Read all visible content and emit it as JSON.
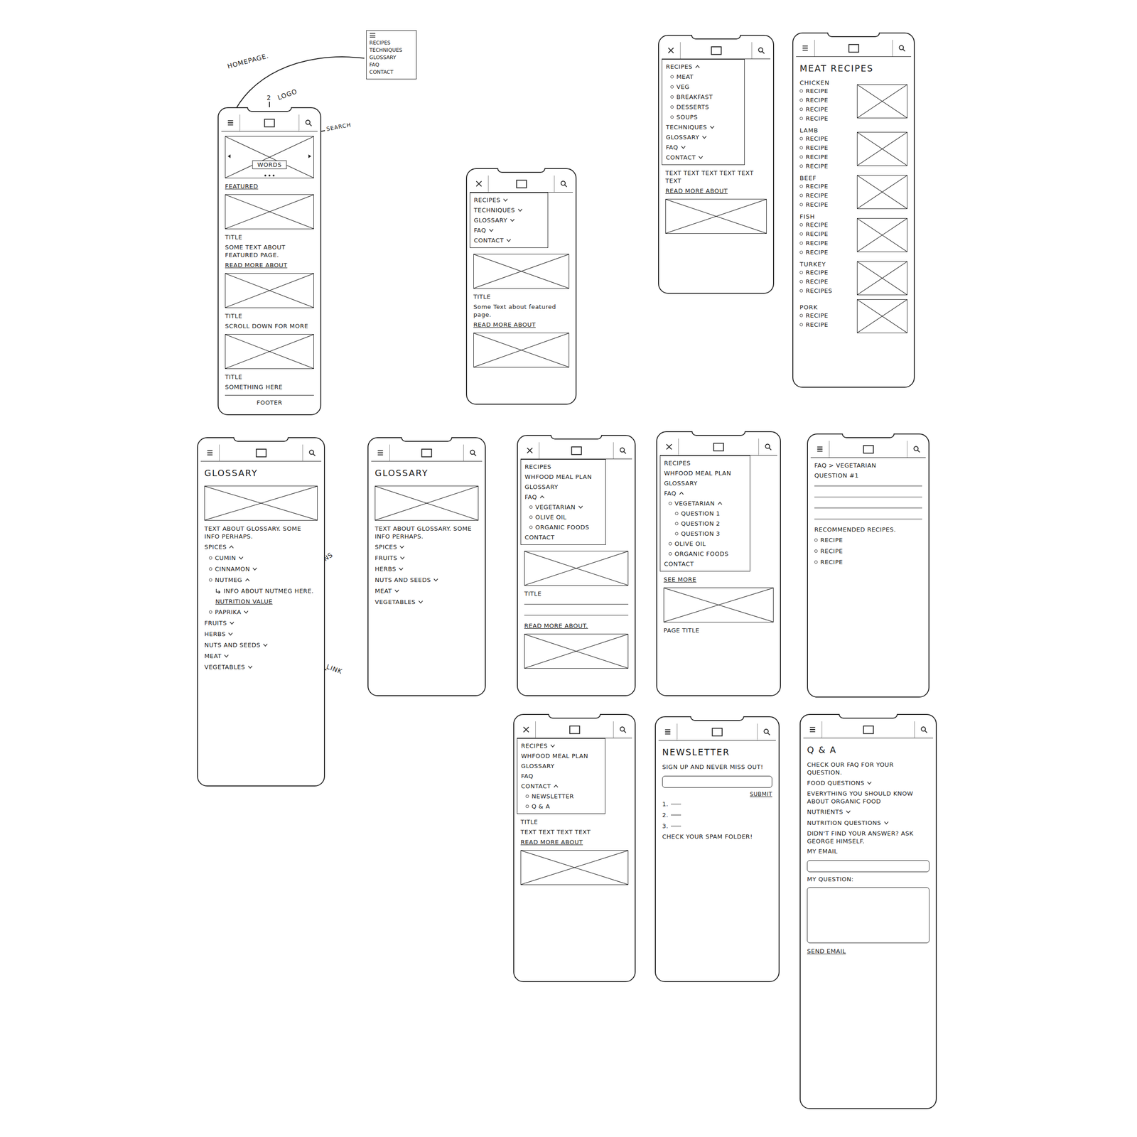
{
  "annotations": [
    {
      "text": "HOMEPAGE."
    },
    {
      "text": "2"
    },
    {
      "text": "LOGO"
    },
    {
      "text": "SEARCH"
    },
    {
      "text": "DROP DOWNS"
    },
    {
      "text": "LINK"
    }
  ],
  "menu_note": {
    "items": [
      "RECIPES",
      "TECHNIQUES",
      "GLOSSARY",
      "FAQ",
      "CONTACT"
    ]
  },
  "screens": [
    {
      "menu_open": false,
      "blocks": [
        {
          "kind": "carousel",
          "text": "WORDS"
        },
        {
          "kind": "link",
          "text": "FEATURED"
        },
        {
          "kind": "image"
        },
        {
          "kind": "text",
          "text": "TITLE"
        },
        {
          "kind": "text",
          "text": "SOME TEXT ABOUT FEATURED PAGE."
        },
        {
          "kind": "link",
          "text": "READ MORE ABOUT"
        },
        {
          "kind": "image"
        },
        {
          "kind": "text",
          "text": "TITLE"
        },
        {
          "kind": "text",
          "text": "SCROLL DOWN FOR MORE"
        },
        {
          "kind": "image"
        },
        {
          "kind": "text",
          "text": "TITLE"
        },
        {
          "kind": "text",
          "text": "SOMETHING HERE"
        },
        {
          "kind": "footer",
          "text": "FOOTER"
        }
      ]
    },
    {
      "menu_open": true,
      "blocks": [
        {
          "kind": "menu",
          "items": [
            {
              "kind": "toggle",
              "text": "RECIPES",
              "expanded": false,
              "level": 0
            },
            {
              "kind": "toggle",
              "text": "TECHNIQUES",
              "expanded": false,
              "level": 0
            },
            {
              "kind": "toggle",
              "text": "GLOSSARY",
              "expanded": false,
              "level": 0
            },
            {
              "kind": "toggle",
              "text": "FAQ",
              "expanded": false,
              "level": 0
            },
            {
              "kind": "toggle",
              "text": "CONTACT",
              "expanded": false,
              "level": 0
            }
          ]
        },
        {
          "kind": "image"
        },
        {
          "kind": "text",
          "text": "TITLE"
        },
        {
          "kind": "text",
          "text": "Some Text about featured page."
        },
        {
          "kind": "link",
          "text": "READ MORE ABOUT"
        },
        {
          "kind": "image"
        }
      ]
    },
    {
      "menu_open": true,
      "blocks": [
        {
          "kind": "menu",
          "items": [
            {
              "kind": "toggle",
              "text": "RECIPES",
              "expanded": true,
              "level": 0
            },
            {
              "kind": "item",
              "text": "MEAT",
              "level": 1
            },
            {
              "kind": "item",
              "text": "VEG",
              "level": 1
            },
            {
              "kind": "item",
              "text": "BREAKFAST",
              "level": 1
            },
            {
              "kind": "item",
              "text": "DESSERTS",
              "level": 1
            },
            {
              "kind": "item",
              "text": "SOUPS",
              "level": 1
            },
            {
              "kind": "toggle",
              "text": "TECHNIQUES",
              "expanded": false,
              "level": 0
            },
            {
              "kind": "toggle",
              "text": "GLOSSARY",
              "expanded": false,
              "level": 0
            },
            {
              "kind": "toggle",
              "text": "FAQ",
              "expanded": false,
              "level": 0
            },
            {
              "kind": "toggle",
              "text": "CONTACT",
              "expanded": false,
              "level": 0
            }
          ]
        },
        {
          "kind": "text",
          "text": "TEXT TEXT TEXT TEXT TEXT TEXT"
        },
        {
          "kind": "link",
          "text": "READ MORE ABOUT"
        },
        {
          "kind": "image"
        }
      ]
    },
    {
      "menu_open": false,
      "blocks": [
        {
          "kind": "heading",
          "text": "MEAT RECIPES"
        },
        {
          "kind": "group",
          "title": "CHICKEN",
          "items": [
            "RECIPE",
            "RECIPE",
            "RECIPE",
            "RECIPE"
          ]
        },
        {
          "kind": "group",
          "title": "LAMB",
          "items": [
            "RECIPE",
            "RECIPE",
            "RECIPE",
            "RECIPE"
          ]
        },
        {
          "kind": "group",
          "title": "BEEF",
          "items": [
            "RECIPE",
            "RECIPE",
            "RECIPE"
          ]
        },
        {
          "kind": "group",
          "title": "FISH",
          "items": [
            "RECIPE",
            "RECIPE",
            "RECIPE",
            "RECIPE"
          ]
        },
        {
          "kind": "group",
          "title": "TURKEY",
          "items": [
            "RECIPE",
            "RECIPE",
            "RECIPES"
          ]
        },
        {
          "kind": "group",
          "title": "PORK",
          "items": [
            "RECIPE",
            "RECIPE"
          ]
        }
      ]
    },
    {
      "menu_open": false,
      "blocks": [
        {
          "kind": "heading",
          "text": "GLOSSARY"
        },
        {
          "kind": "image"
        },
        {
          "kind": "text",
          "text": "TEXT ABOUT GLOSSARY. SOME INFO PERHAPS."
        },
        {
          "kind": "toggle",
          "text": "SPICES",
          "expanded": true,
          "level": 0
        },
        {
          "kind": "toggle",
          "text": "CUMIN",
          "expanded": false,
          "level": 1
        },
        {
          "kind": "toggle",
          "text": "CINNAMON",
          "expanded": false,
          "level": 1
        },
        {
          "kind": "toggle",
          "text": "NUTMEG",
          "expanded": true,
          "level": 1
        },
        {
          "kind": "note",
          "text": "INFO ABOUT NUTMEG HERE.",
          "level": 2
        },
        {
          "kind": "link",
          "text": "NUTRITION VALUE",
          "level": 2
        },
        {
          "kind": "toggle",
          "text": "PAPRIKA",
          "expanded": false,
          "level": 1
        },
        {
          "kind": "toggle",
          "text": "FRUITS",
          "expanded": false,
          "level": 0
        },
        {
          "kind": "toggle",
          "text": "HERBS",
          "expanded": false,
          "level": 0
        },
        {
          "kind": "toggle",
          "text": "NUTS AND SEEDS",
          "expanded": false,
          "level": 0
        },
        {
          "kind": "toggle",
          "text": "MEAT",
          "expanded": false,
          "level": 0
        },
        {
          "kind": "toggle",
          "text": "VEGETABLES",
          "expanded": false,
          "level": 0
        }
      ]
    },
    {
      "menu_open": false,
      "blocks": [
        {
          "kind": "heading",
          "text": "GLOSSARY"
        },
        {
          "kind": "image"
        },
        {
          "kind": "text",
          "text": "TEXT ABOUT GLOSSARY. SOME INFO PERHAPS."
        },
        {
          "kind": "toggle",
          "text": "SPICES",
          "expanded": false,
          "level": 0
        },
        {
          "kind": "toggle",
          "text": "FRUITS",
          "expanded": false,
          "level": 0
        },
        {
          "kind": "toggle",
          "text": "HERBS",
          "expanded": false,
          "level": 0
        },
        {
          "kind": "toggle",
          "text": "NUTS AND SEEDS",
          "expanded": false,
          "level": 0
        },
        {
          "kind": "toggle",
          "text": "MEAT",
          "expanded": false,
          "level": 0
        },
        {
          "kind": "toggle",
          "text": "VEGETABLES",
          "expanded": false,
          "level": 0
        }
      ]
    },
    {
      "menu_open": true,
      "blocks": [
        {
          "kind": "menu",
          "items": [
            {
              "kind": "entry",
              "text": "RECIPES",
              "level": 0
            },
            {
              "kind": "entry",
              "text": "WHFOOD MEAL PLAN",
              "level": 0
            },
            {
              "kind": "entry",
              "text": "GLOSSARY",
              "level": 0
            },
            {
              "kind": "toggle",
              "text": "FAQ",
              "expanded": true,
              "level": 0
            },
            {
              "kind": "toggle",
              "text": "VEGETARIAN",
              "expanded": false,
              "level": 1
            },
            {
              "kind": "item",
              "text": "OLIVE OIL",
              "level": 1
            },
            {
              "kind": "item",
              "text": "ORGANIC FOODS",
              "level": 1
            },
            {
              "kind": "entry",
              "text": "CONTACT",
              "level": 0
            }
          ]
        },
        {
          "kind": "image"
        },
        {
          "kind": "text",
          "text": "TITLE"
        },
        {
          "kind": "rule"
        },
        {
          "kind": "rule"
        },
        {
          "kind": "link",
          "text": "READ MORE ABOUT."
        },
        {
          "kind": "image"
        }
      ]
    },
    {
      "menu_open": true,
      "blocks": [
        {
          "kind": "menu",
          "items": [
            {
              "kind": "entry",
              "text": "RECIPES",
              "level": 0
            },
            {
              "kind": "entry",
              "text": "WHFOOD MEAL PLAN",
              "level": 0
            },
            {
              "kind": "entry",
              "text": "GLOSSARY",
              "level": 0
            },
            {
              "kind": "toggle",
              "text": "FAQ",
              "expanded": true,
              "level": 0
            },
            {
              "kind": "toggle",
              "text": "VEGETARIAN",
              "expanded": true,
              "level": 1
            },
            {
              "kind": "item",
              "text": "QUESTION 1",
              "level": 2
            },
            {
              "kind": "item",
              "text": "QUESTION 2",
              "level": 2
            },
            {
              "kind": "item",
              "text": "QUESTION 3",
              "level": 2
            },
            {
              "kind": "item",
              "text": "OLIVE OIL",
              "level": 1
            },
            {
              "kind": "item",
              "text": "ORGANIC FOODS",
              "level": 1
            },
            {
              "kind": "entry",
              "text": "CONTACT",
              "level": 0
            }
          ]
        },
        {
          "kind": "link",
          "text": "SEE MORE"
        },
        {
          "kind": "image"
        },
        {
          "kind": "text",
          "text": "PAGE TITLE"
        }
      ]
    },
    {
      "menu_open": false,
      "blocks": [
        {
          "kind": "text",
          "text": "FAQ > VEGETARIAN"
        },
        {
          "kind": "text",
          "text": "QUESTION #1"
        },
        {
          "kind": "rule"
        },
        {
          "kind": "rule"
        },
        {
          "kind": "rule"
        },
        {
          "kind": "rule"
        },
        {
          "kind": "text",
          "text": "RECOMMENDED RECIPES."
        },
        {
          "kind": "item",
          "text": "RECIPE",
          "level": 0
        },
        {
          "kind": "item",
          "text": "RECIPE",
          "level": 0
        },
        {
          "kind": "item",
          "text": "RECIPE",
          "level": 0
        }
      ]
    },
    {
      "menu_open": true,
      "blocks": [
        {
          "kind": "menu",
          "items": [
            {
              "kind": "toggle",
              "text": "RECIPES",
              "expanded": false,
              "level": 0
            },
            {
              "kind": "entry",
              "text": "WHFOOD MEAL PLAN",
              "level": 0
            },
            {
              "kind": "entry",
              "text": "GLOSSARY",
              "level": 0
            },
            {
              "kind": "entry",
              "text": "FAQ",
              "level": 0
            },
            {
              "kind": "toggle",
              "text": "CONTACT",
              "expanded": true,
              "level": 0
            },
            {
              "kind": "item",
              "text": "NEWSLETTER",
              "level": 1
            },
            {
              "kind": "item",
              "text": "Q & A",
              "level": 1
            }
          ]
        },
        {
          "kind": "text",
          "text": "TITLE"
        },
        {
          "kind": "text",
          "text": "TEXT TEXT TEXT TEXT"
        },
        {
          "kind": "link",
          "text": "READ MORE ABOUT"
        },
        {
          "kind": "image"
        }
      ]
    },
    {
      "menu_open": false,
      "blocks": [
        {
          "kind": "heading",
          "text": "NEWSLETTER"
        },
        {
          "kind": "text",
          "text": "SIGN UP AND NEVER MISS OUT!"
        },
        {
          "kind": "input"
        },
        {
          "kind": "button",
          "text": "SUBMIT"
        },
        {
          "kind": "numbered",
          "text": "1."
        },
        {
          "kind": "numbered",
          "text": "2."
        },
        {
          "kind": "numbered",
          "text": "3."
        },
        {
          "kind": "text",
          "text": "CHECK YOUR SPAM FOLDER!"
        }
      ]
    },
    {
      "menu_open": false,
      "blocks": [
        {
          "kind": "heading",
          "text": "Q & A"
        },
        {
          "kind": "text",
          "text": "CHECK OUR FAQ FOR YOUR QUESTION."
        },
        {
          "kind": "toggle",
          "text": "FOOD QUESTIONS",
          "expanded": false,
          "level": 0
        },
        {
          "kind": "text",
          "text": "EVERYTHING YOU SHOULD KNOW ABOUT ORGANIC FOOD"
        },
        {
          "kind": "toggle",
          "text": "NUTRIENTS",
          "expanded": false,
          "level": 0
        },
        {
          "kind": "toggle",
          "text": "NUTRITION QUESTIONS",
          "expanded": false,
          "level": 0
        },
        {
          "kind": "text",
          "text": "DIDN'T FIND YOUR ANSWER? ASK GEORGE HIMSELF."
        },
        {
          "kind": "text",
          "text": "MY EMAIL"
        },
        {
          "kind": "input"
        },
        {
          "kind": "text",
          "text": "MY QUESTION:"
        },
        {
          "kind": "textarea"
        },
        {
          "kind": "link",
          "text": "SEND EMAIL"
        }
      ]
    }
  ]
}
